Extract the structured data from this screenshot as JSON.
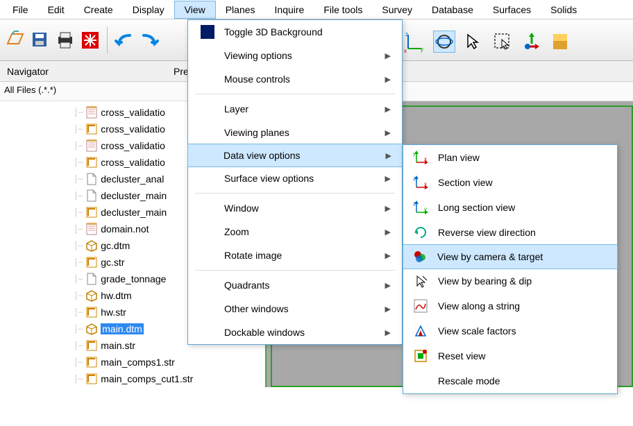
{
  "menubar": [
    "File",
    "Edit",
    "Create",
    "Display",
    "View",
    "Planes",
    "Inquire",
    "File tools",
    "Survey",
    "Database",
    "Surfaces",
    "Solids"
  ],
  "menubar_active_index": 4,
  "panels": {
    "navigator": "Navigator",
    "preview": "Pre"
  },
  "filter": "All Files (.*.*)",
  "files": [
    {
      "name": "cross_validatio",
      "icon": "notes"
    },
    {
      "name": "cross_validatio",
      "icon": "str"
    },
    {
      "name": "cross_validatio",
      "icon": "notes"
    },
    {
      "name": "cross_validatio",
      "icon": "str"
    },
    {
      "name": "decluster_anal",
      "icon": "doc"
    },
    {
      "name": "decluster_main",
      "icon": "doc"
    },
    {
      "name": "decluster_main",
      "icon": "str"
    },
    {
      "name": "domain.not",
      "icon": "notes"
    },
    {
      "name": "gc.dtm",
      "icon": "dtm"
    },
    {
      "name": "gc.str",
      "icon": "str"
    },
    {
      "name": "grade_tonnage",
      "icon": "doc"
    },
    {
      "name": "hw.dtm",
      "icon": "dtm"
    },
    {
      "name": "hw.str",
      "icon": "str"
    },
    {
      "name": "main.dtm",
      "icon": "dtm",
      "selected": true
    },
    {
      "name": "main.str",
      "icon": "str"
    },
    {
      "name": "main_comps1.str",
      "icon": "str"
    },
    {
      "name": "main_comps_cut1.str",
      "icon": "str"
    }
  ],
  "view_menu": [
    {
      "label": "Toggle 3D Background",
      "icon": "cube",
      "arrow": false
    },
    {
      "label": "Viewing options",
      "arrow": true
    },
    {
      "label": "Mouse controls",
      "arrow": true
    },
    {
      "sep": true
    },
    {
      "label": "Layer",
      "arrow": true
    },
    {
      "label": "Viewing planes",
      "arrow": true
    },
    {
      "label": "Data view options",
      "arrow": true,
      "highlight": true
    },
    {
      "label": "Surface view options",
      "arrow": true
    },
    {
      "sep": true
    },
    {
      "label": "Window",
      "arrow": true
    },
    {
      "label": "Zoom",
      "arrow": true
    },
    {
      "label": "Rotate image",
      "arrow": true
    },
    {
      "sep": true
    },
    {
      "label": "Quadrants",
      "arrow": true
    },
    {
      "label": "Other windows",
      "arrow": true
    },
    {
      "label": "Dockable windows",
      "arrow": true
    }
  ],
  "submenu": [
    {
      "label": "Plan view",
      "icon": "axis-yx"
    },
    {
      "label": "Section view",
      "icon": "axis-zx"
    },
    {
      "label": "Long section view",
      "icon": "axis-zy"
    },
    {
      "label": "Reverse view direction",
      "icon": "reverse"
    },
    {
      "label": "View by camera & target",
      "icon": "camera",
      "highlight": true
    },
    {
      "label": "View by bearing & dip",
      "icon": "bearing"
    },
    {
      "label": "View along a string",
      "icon": "string"
    },
    {
      "label": "View scale factors",
      "icon": "scale"
    },
    {
      "label": "Reset view",
      "icon": "reset"
    },
    {
      "label": "Rescale mode",
      "icon": "blank"
    }
  ]
}
